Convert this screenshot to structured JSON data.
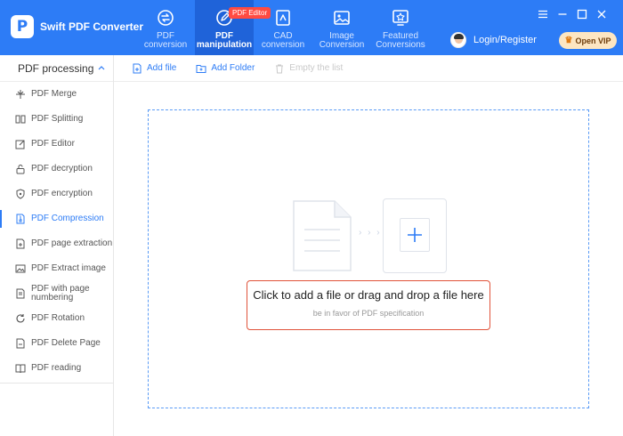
{
  "app": {
    "name": "Swift PDF Converter",
    "logo_letter": "P"
  },
  "nav": {
    "items": [
      {
        "label": "PDF\nconversion",
        "icon": "convert-icon"
      },
      {
        "label": "PDF\nmanipulation",
        "icon": "edit-icon",
        "active": true,
        "badge": "PDF Editor"
      },
      {
        "label": "CAD\nconversion",
        "icon": "cad-icon"
      },
      {
        "label": "Image\nConversion",
        "icon": "image-icon"
      },
      {
        "label": "Featured\nConversions",
        "icon": "star-icon"
      }
    ]
  },
  "header": {
    "login_label": "Login/Register",
    "vip_label": "Open VIP"
  },
  "sidebar": {
    "header": "PDF processing",
    "items": [
      {
        "label": "PDF Merge",
        "icon": "merge-icon"
      },
      {
        "label": "PDF Splitting",
        "icon": "split-icon"
      },
      {
        "label": "PDF Editor",
        "icon": "editor-icon"
      },
      {
        "label": "PDF decryption",
        "icon": "unlock-icon"
      },
      {
        "label": "PDF encryption",
        "icon": "shield-icon"
      },
      {
        "label": "PDF Compression",
        "icon": "compress-icon",
        "active": true
      },
      {
        "label": "PDF page extraction",
        "icon": "page-extract-icon"
      },
      {
        "label": "PDF Extract image",
        "icon": "image-extract-icon"
      },
      {
        "label": "PDF with page numbering",
        "icon": "page-number-icon"
      },
      {
        "label": "PDF Rotation",
        "icon": "rotate-icon"
      },
      {
        "label": "PDF Delete Page",
        "icon": "delete-page-icon"
      },
      {
        "label": "PDF reading",
        "icon": "book-icon"
      }
    ]
  },
  "toolbar": {
    "add_file": "Add file",
    "add_folder": "Add Folder",
    "empty_list": "Empty the list"
  },
  "dropzone": {
    "title": "Click to add a file or drag and drop a file here",
    "subtitle": "be in favor of PDF specification",
    "arrows": "› › ›"
  },
  "colors": {
    "primary": "#2d7cf6",
    "active_nav": "#1f63d9",
    "badge": "#ff4b42",
    "cta_border": "#e0533a",
    "vip_bg": "#fde6c2"
  }
}
